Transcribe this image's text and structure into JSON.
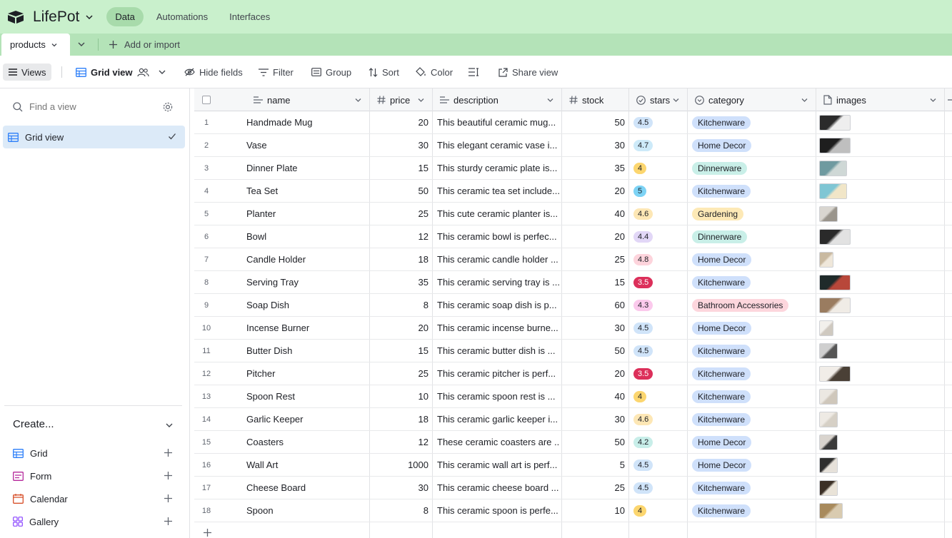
{
  "app": {
    "title": "LifePot"
  },
  "nav": [
    {
      "label": "Data",
      "active": true
    },
    {
      "label": "Automations",
      "active": false
    },
    {
      "label": "Interfaces",
      "active": false
    }
  ],
  "tables": {
    "active_tab": "products",
    "add_import": "Add or import"
  },
  "toolbar": {
    "views": "Views",
    "grid_view": "Grid view",
    "hide_fields": "Hide fields",
    "filter": "Filter",
    "group": "Group",
    "sort": "Sort",
    "color": "Color",
    "share_view": "Share view"
  },
  "sidebar": {
    "find_placeholder": "Find a view",
    "active_view": "Grid view",
    "create_label": "Create...",
    "create_items": [
      {
        "label": "Grid",
        "icon": "grid-icon",
        "color": "#2d7ff9"
      },
      {
        "label": "Form",
        "icon": "form-icon",
        "color": "#b5279b"
      },
      {
        "label": "Calendar",
        "icon": "calendar-icon",
        "color": "#d7502a"
      },
      {
        "label": "Gallery",
        "icon": "gallery-icon",
        "color": "#8b46ff"
      }
    ]
  },
  "columns": [
    "name",
    "price",
    "description",
    "stock",
    "stars",
    "category",
    "images"
  ],
  "rows": [
    {
      "num": "1",
      "name": "Handmade Mug",
      "price": "20",
      "description": "This beautiful ceramic mug...",
      "stock": "50",
      "stars": "4.5",
      "category": "Kitchenware",
      "thumb": [
        "#2b2b2b",
        "#eeeeee"
      ],
      "thumb_w": 44
    },
    {
      "num": "2",
      "name": "Vase",
      "price": "30",
      "description": "This elegant ceramic vase i...",
      "stock": "30",
      "stars": "4.7",
      "category": "Home Decor",
      "thumb": [
        "#1e1e1e",
        "#bfbfbf"
      ],
      "thumb_w": 44
    },
    {
      "num": "3",
      "name": "Dinner Plate",
      "price": "15",
      "description": "This sturdy ceramic plate is...",
      "stock": "35",
      "stars": "4",
      "category": "Dinnerware",
      "thumb": [
        "#6f9aa0",
        "#cfd8d6"
      ],
      "thumb_w": 39
    },
    {
      "num": "4",
      "name": "Tea Set",
      "price": "50",
      "description": "This ceramic tea set include...",
      "stock": "20",
      "stars": "5",
      "category": "Kitchenware",
      "thumb": [
        "#7fc6d4",
        "#f1e6c8"
      ],
      "thumb_w": 39
    },
    {
      "num": "5",
      "name": "Planter",
      "price": "25",
      "description": "This cute ceramic planter is...",
      "stock": "40",
      "stars": "4.6",
      "category": "Gardening",
      "thumb": [
        "#d9d6d0",
        "#9a958c"
      ],
      "thumb_w": 26
    },
    {
      "num": "6",
      "name": "Bowl",
      "price": "12",
      "description": "This ceramic bowl is perfec...",
      "stock": "20",
      "stars": "4.4",
      "category": "Dinnerware",
      "thumb": [
        "#2a2a2a",
        "#e2e2e2"
      ],
      "thumb_w": 44
    },
    {
      "num": "7",
      "name": "Candle Holder",
      "price": "18",
      "description": "This ceramic candle holder ...",
      "stock": "25",
      "stars": "4.8",
      "category": "Home Decor",
      "thumb": [
        "#c9b9a0",
        "#efe7da"
      ],
      "thumb_w": 20
    },
    {
      "num": "8",
      "name": "Serving Tray",
      "price": "35",
      "description": "This ceramic serving tray is ...",
      "stock": "15",
      "stars": "3.5",
      "category": "Kitchenware",
      "thumb": [
        "#1f2a2a",
        "#b8473a"
      ],
      "thumb_w": 44
    },
    {
      "num": "9",
      "name": "Soap Dish",
      "price": "8",
      "description": "This ceramic soap dish is p...",
      "stock": "60",
      "stars": "4.3",
      "category": "Bathroom Accessories",
      "thumb": [
        "#9a7c60",
        "#f0ece6"
      ],
      "thumb_w": 44
    },
    {
      "num": "10",
      "name": "Incense Burner",
      "price": "20",
      "description": "This ceramic incense burne...",
      "stock": "30",
      "stars": "4.5",
      "category": "Home Decor",
      "thumb": [
        "#f2f0ec",
        "#cfc9c0"
      ],
      "thumb_w": 20
    },
    {
      "num": "11",
      "name": "Butter Dish",
      "price": "15",
      "description": "This ceramic butter dish is ...",
      "stock": "50",
      "stars": "4.5",
      "category": "Kitchenware",
      "thumb": [
        "#cfcfcf",
        "#555555"
      ],
      "thumb_w": 26
    },
    {
      "num": "12",
      "name": "Pitcher",
      "price": "25",
      "description": "This ceramic pitcher is perf...",
      "stock": "20",
      "stars": "3.5",
      "category": "Kitchenware",
      "thumb": [
        "#f1ede8",
        "#4a4036"
      ],
      "thumb_w": 44
    },
    {
      "num": "13",
      "name": "Spoon Rest",
      "price": "10",
      "description": "This ceramic spoon rest is ...",
      "stock": "40",
      "stars": "4",
      "category": "Kitchenware",
      "thumb": [
        "#ece8e2",
        "#cfc7bb"
      ],
      "thumb_w": 26
    },
    {
      "num": "14",
      "name": "Garlic Keeper",
      "price": "18",
      "description": "This ceramic garlic keeper i...",
      "stock": "30",
      "stars": "4.6",
      "category": "Kitchenware",
      "thumb": [
        "#eeeae4",
        "#d6d0c6"
      ],
      "thumb_w": 26
    },
    {
      "num": "15",
      "name": "Coasters",
      "price": "12",
      "description": "These ceramic coasters are ...",
      "stock": "50",
      "stars": "4.2",
      "category": "Home Decor",
      "thumb": [
        "#d9d4ce",
        "#3a3a3a"
      ],
      "thumb_w": 26
    },
    {
      "num": "16",
      "name": "Wall Art",
      "price": "1000",
      "description": "This ceramic wall art is perf...",
      "stock": "5",
      "stars": "4.5",
      "category": "Home Decor",
      "thumb": [
        "#2e2e2e",
        "#e6e1da"
      ],
      "thumb_w": 26
    },
    {
      "num": "17",
      "name": "Cheese Board",
      "price": "30",
      "description": "This ceramic cheese board ...",
      "stock": "25",
      "stars": "4.5",
      "category": "Kitchenware",
      "thumb": [
        "#3b3026",
        "#e9e3d8"
      ],
      "thumb_w": 26
    },
    {
      "num": "18",
      "name": "Spoon",
      "price": "8",
      "description": "This ceramic spoon is perfe...",
      "stock": "10",
      "stars": "4",
      "category": "Kitchenware",
      "thumb": [
        "#a88a5c",
        "#d9cbb0"
      ],
      "thumb_w": 33
    }
  ],
  "star_colors": {
    "4.5": "#d0e4f9",
    "4.7": "#cdeaf9",
    "4": "#fcd66f",
    "5": "#7dd3f5",
    "4.6": "#fde7b5",
    "4.4": "#e2d7f7",
    "4.8": "#fdd4dc",
    "3.5": "#dc2f5a",
    "4.3": "#fbc9ec",
    "4.2": "#c8eee9"
  },
  "category_colors": {
    "Kitchenware": "#cfe0fb",
    "Home Decor": "#cfe0fb",
    "Dinnerware": "#c9efe8",
    "Gardening": "#fde9b6",
    "Bathroom Accessories": "#fdd6dd"
  }
}
